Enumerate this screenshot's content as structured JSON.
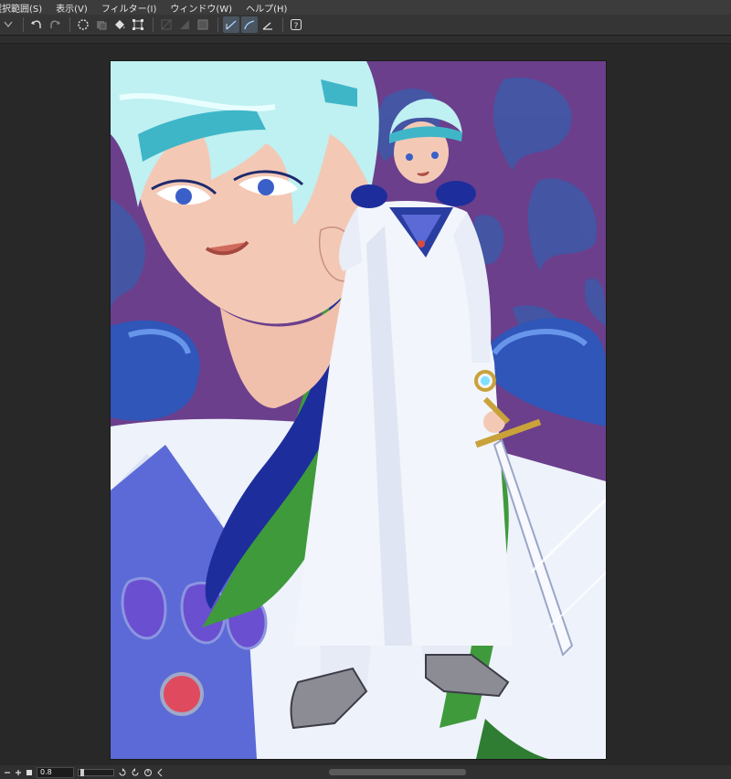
{
  "menu": {
    "items": [
      "選択範囲(S)",
      "表示(V)",
      "フィルター(I)",
      "ウィンドウ(W)",
      "ヘルプ(H)"
    ]
  },
  "toolbar": {
    "icons": [
      "undo-icon",
      "redo-icon",
      "loading-icon",
      "clear-icon",
      "fill-icon",
      "transform-icon",
      "snap-off-icon",
      "snap-special-icon",
      "snap-grid-icon",
      "ruler-straight-icon",
      "ruler-curve-icon",
      "ruler-angle-icon",
      "help-icon"
    ]
  },
  "status": {
    "zoom_value": "0.8",
    "controls": [
      "minus",
      "plus",
      "stop"
    ]
  },
  "colors": {
    "accent": "#4a5560",
    "canvas_bg": "#6d3f8a",
    "cloak_green": "#3f9a3c",
    "hair": "#bff0f2",
    "blue": "#2f4ba8"
  },
  "canvas": {
    "subject": "illustration-silver-haired-knight"
  }
}
